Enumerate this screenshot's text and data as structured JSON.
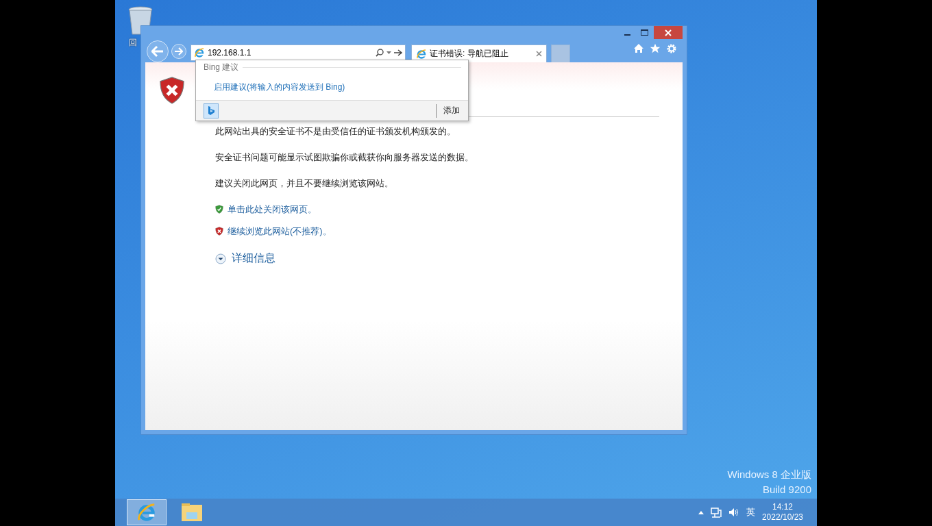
{
  "desktop": {
    "icons": [
      {
        "label": "回"
      }
    ],
    "edition": [
      "Windows 8 企业版",
      "Build 9200"
    ]
  },
  "browser": {
    "address": "192.168.1.1",
    "tabs": [
      {
        "title": "证书错误: 导航已阻止",
        "selected": true
      }
    ],
    "suggestions": {
      "header": "Bing 建议",
      "link": "启用建议(将输入的内容发送到 Bing)",
      "add": "添加"
    },
    "page": {
      "paragraphs": [
        "此网站出具的安全证书不是由受信任的证书颁发机构颁发的。",
        "安全证书问题可能显示试图欺骗你或截获你向服务器发送的数据。",
        "建议关闭此网页，并且不要继续浏览该网站。"
      ],
      "links": [
        {
          "kind": "safe",
          "text": "单击此处关闭该网页。"
        },
        {
          "kind": "unsafe",
          "text": "继续浏览此网站(不推荐)。"
        }
      ],
      "details": {
        "label": "详细信息",
        "expanded": false
      }
    }
  },
  "taskbar": {
    "apps": [
      {
        "kind": "ie",
        "selected": true
      },
      {
        "kind": "explorer",
        "selected": false
      }
    ],
    "ime": "英",
    "time": "14:12",
    "date": "2022/10/23"
  }
}
